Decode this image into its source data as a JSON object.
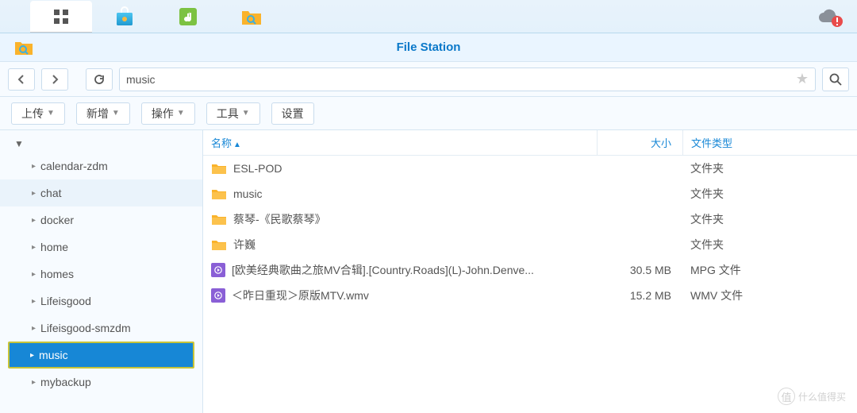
{
  "taskbar": {
    "items": [
      {
        "name": "apps",
        "color": "#555"
      },
      {
        "name": "package-center",
        "color": "#f5a623"
      },
      {
        "name": "music-app",
        "color": "#7cc242"
      },
      {
        "name": "file-station",
        "color": "#fab32b"
      }
    ]
  },
  "window": {
    "title": "File Station"
  },
  "path": {
    "value": "music"
  },
  "toolbar": {
    "upload": "上传",
    "create": "新增",
    "action": "操作",
    "tools": "工具",
    "settings": "设置"
  },
  "sidebar": {
    "items": [
      {
        "label": "calendar-zdm"
      },
      {
        "label": "chat",
        "highlight": "light"
      },
      {
        "label": "docker"
      },
      {
        "label": "home"
      },
      {
        "label": "homes"
      },
      {
        "label": "Lifeisgood"
      },
      {
        "label": "Lifeisgood-smzdm"
      },
      {
        "label": "music",
        "selected": true
      },
      {
        "label": "mybackup"
      }
    ]
  },
  "columns": {
    "name": "名称",
    "size": "大小",
    "type": "文件类型"
  },
  "files": [
    {
      "icon": "folder",
      "name": "ESL-POD",
      "size": "",
      "type": "文件夹"
    },
    {
      "icon": "folder",
      "name": "music",
      "size": "",
      "type": "文件夹"
    },
    {
      "icon": "folder",
      "name": "蔡琴-《民歌蔡琴》",
      "size": "",
      "type": "文件夹"
    },
    {
      "icon": "folder",
      "name": "许巍",
      "size": "",
      "type": "文件夹"
    },
    {
      "icon": "video",
      "name": "[欧美经典歌曲之旅MV合辑].[Country.Roads](L)-John.Denve...",
      "size": "30.5 MB",
      "type": "MPG 文件"
    },
    {
      "icon": "video",
      "name": "＜昨日重现＞原版MTV.wmv",
      "size": "15.2 MB",
      "type": "WMV 文件"
    }
  ],
  "watermark": {
    "text": "什么值得买"
  }
}
